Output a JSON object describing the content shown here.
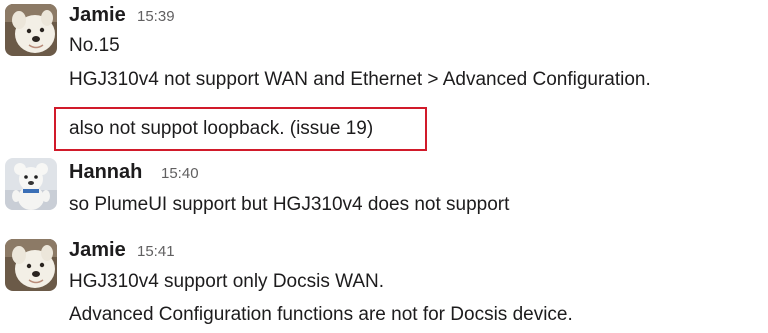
{
  "messages": [
    {
      "author": "Jamie",
      "time": "15:39",
      "avatar": "dog-avatar-icon",
      "lines": [
        "No.15",
        "HGJ310v4 not support WAN and Ethernet > Advanced Configuration.",
        "also not suppot loopback. (issue 19)"
      ]
    },
    {
      "author": "Hannah",
      "time": "15:40",
      "avatar": "bear-avatar-icon",
      "lines": [
        "so PlumeUI support but HGJ310v4 does not support"
      ]
    },
    {
      "author": "Jamie",
      "time": "15:41",
      "avatar": "dog-avatar-icon",
      "lines": [
        "HGJ310v4 support only Docsis WAN.",
        "Advanced Configuration functions are not for Docsis device."
      ]
    }
  ],
  "colors": {
    "highlight_border": "#d11a2a",
    "timestamp": "#616061",
    "text": "#1d1c1d"
  }
}
